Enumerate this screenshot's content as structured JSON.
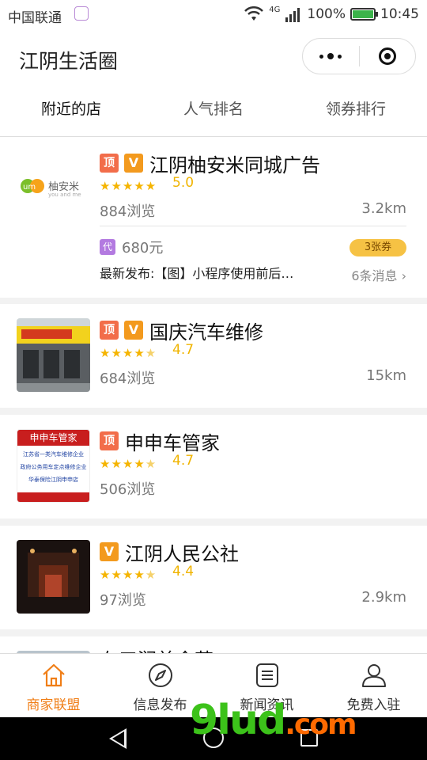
{
  "status_bar": {
    "carrier": "中国联通",
    "network": "4G",
    "battery": "100%",
    "time": "10:45",
    "battery_level": 1.0
  },
  "nav": {
    "title": "江阴生活圈"
  },
  "tabs": [
    {
      "label": "附近的店",
      "active": true
    },
    {
      "label": "人气排名",
      "active": false
    },
    {
      "label": "领券排行",
      "active": false
    }
  ],
  "shops": [
    {
      "badge_top": "顶",
      "badge_v": "V",
      "name": "江阴柚安米同城广告",
      "thumb_text": "柚安米",
      "thumb_sub": "you and me",
      "rating": "5.0",
      "views": "884浏览",
      "distance": "3.2km",
      "dai": "代",
      "price": "680元",
      "coupon": "3张券",
      "latest": "最新发布:【图】小程序使用前后…",
      "messages": "6条消息"
    },
    {
      "badge_top": "顶",
      "badge_v": "V",
      "name": "国庆汽车维修",
      "rating": "4.7",
      "views": "684浏览",
      "distance": "15km"
    },
    {
      "badge_top": "顶",
      "name": "申申车管家",
      "rating": "4.7",
      "views": "506浏览",
      "thumb_lines": [
        "申申车管家",
        "江苏省一类汽车维修企业",
        "政府公务用车定点维修企业",
        "华泰保险江阴申申店"
      ]
    },
    {
      "badge_v": "V",
      "name": "江阴人民公社",
      "rating": "4.4",
      "views": "97浏览",
      "distance": "2.9km"
    },
    {
      "name": "有三润美食苑"
    }
  ],
  "tabbar": [
    {
      "label": "商家联盟",
      "icon": "home-icon",
      "active": true
    },
    {
      "label": "信息发布",
      "icon": "compass-icon",
      "active": false
    },
    {
      "label": "新闻资讯",
      "icon": "news-icon",
      "active": false
    },
    {
      "label": "免费入驻",
      "icon": "user-icon",
      "active": false
    }
  ],
  "watermark": {
    "brand": "9lud",
    "suffix": ".com"
  },
  "colors": {
    "accent": "#f07e16",
    "star": "#f5b400",
    "badge_top": "#f26d4a",
    "badge_v": "#f39a1e"
  }
}
